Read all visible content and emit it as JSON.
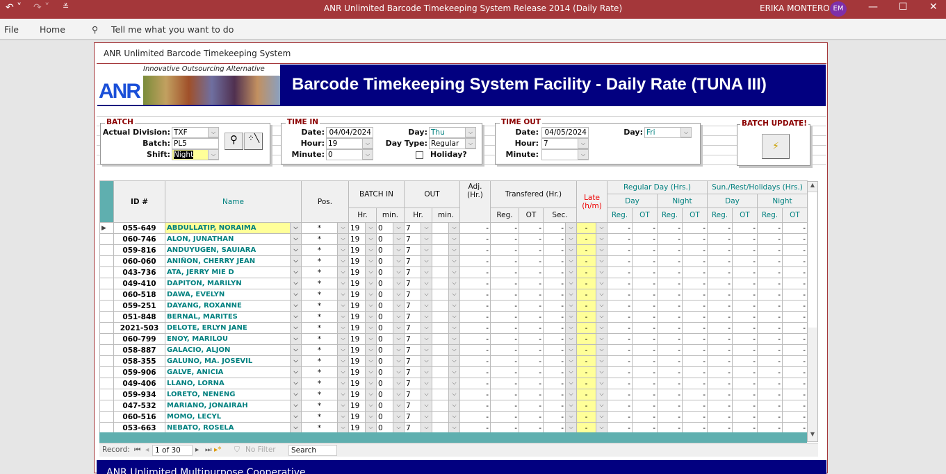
{
  "window": {
    "title": "ANR Unlimited Barcode Timekeeping System  Release 2014 (Daily Rate)",
    "user": "ERIKA MONTERO",
    "initials": "EM"
  },
  "ribbon": {
    "file": "File",
    "home": "Home",
    "tell": "Tell me what you want to do"
  },
  "form": {
    "caption": "ANR Unlimited Barcode Timekeeping System",
    "tagline": "Innovative Outsourcing Alternative",
    "logo": "ANR",
    "banner": "Barcode Timekeeping System Facility - Daily Rate (TUNA III)",
    "footer": "ANR Unlimited Multipurpose Cooperative"
  },
  "batch": {
    "legend": "BATCH",
    "division_label": "Actual Division:",
    "division": "TXF",
    "batch_label": "Batch:",
    "batch": "PL5",
    "shift_label": "Shift:",
    "shift": "Night"
  },
  "time_in": {
    "legend": "TIME IN",
    "date_label": "Date:",
    "date": "04/04/2024",
    "hour_label": "Hour:",
    "hour": "19",
    "minute_label": "Minute:",
    "minute": "0",
    "day_label": "Day:",
    "day": "Thu",
    "daytype_label": "Day Type:",
    "daytype": "Regular",
    "holiday_label": "Holiday?"
  },
  "time_out": {
    "legend": "TIME OUT",
    "date_label": "Date:",
    "date": "04/05/2024",
    "hour_label": "Hour:",
    "hour": "7",
    "minute_label": "Minute:",
    "minute": "",
    "day_label": "Day:",
    "day": "Fri"
  },
  "batch_update": {
    "legend": "BATCH UPDATE!"
  },
  "headers": {
    "id": "ID #",
    "name": "Name",
    "pos": "Pos.",
    "batch_in": "BATCH IN",
    "out": "OUT",
    "hr": "Hr.",
    "min": "min.",
    "adj": "Adj. (Hr.)",
    "transfered": "Transfered (Hr.)",
    "reg": "Reg.",
    "ot": "OT",
    "sec": "Sec.",
    "late": "Late (h/m)",
    "regular_day": "Regular Day (Hrs.)",
    "sun_rest": "Sun./Rest/Holidays (Hrs.)",
    "day": "Day",
    "night": "Night"
  },
  "rows": [
    {
      "id": "055-649",
      "name": "ABDULLATIP, NORAIMA"
    },
    {
      "id": "060-746",
      "name": "ALON, JUNATHAN"
    },
    {
      "id": "059-816",
      "name": "ANDUYUGEN, SAUIARA"
    },
    {
      "id": "060-060",
      "name": "ANIÑON, CHERRY JEAN"
    },
    {
      "id": "043-736",
      "name": "ATA, JERRY MIE D"
    },
    {
      "id": "049-410",
      "name": "DAPITON, MARILYN"
    },
    {
      "id": "060-518",
      "name": "DAWA, EVELYN"
    },
    {
      "id": "059-251",
      "name": "DAYANG, ROXANNE"
    },
    {
      "id": "051-848",
      "name": "BERNAL, MARITES"
    },
    {
      "id": "2021-503",
      "name": "DELOTE, ERLYN JANE"
    },
    {
      "id": "060-799",
      "name": "ENOY, MARILOU"
    },
    {
      "id": "058-887",
      "name": "GALACIO, ALJON"
    },
    {
      "id": "058-355",
      "name": "GALUNO, MA. JOSEVIL"
    },
    {
      "id": "059-906",
      "name": "GALVE, ANICIA"
    },
    {
      "id": "049-406",
      "name": "LLANO, LORNA"
    },
    {
      "id": "059-934",
      "name": "LORETO, NENENG"
    },
    {
      "id": "047-532",
      "name": "MARIANO, JONAIRAH"
    },
    {
      "id": "060-516",
      "name": "MOMO, LECYL"
    },
    {
      "id": "053-663",
      "name": "NEBATO, ROSELA"
    }
  ],
  "row_defaults": {
    "pos": "*",
    "in_hr": "19",
    "in_min": "0",
    "out_hr": "7",
    "out_min": "",
    "dash": "-"
  },
  "navigation": {
    "record_label": "Record:",
    "record": "1 of 30",
    "no_filter": "No Filter",
    "search": "Search"
  }
}
